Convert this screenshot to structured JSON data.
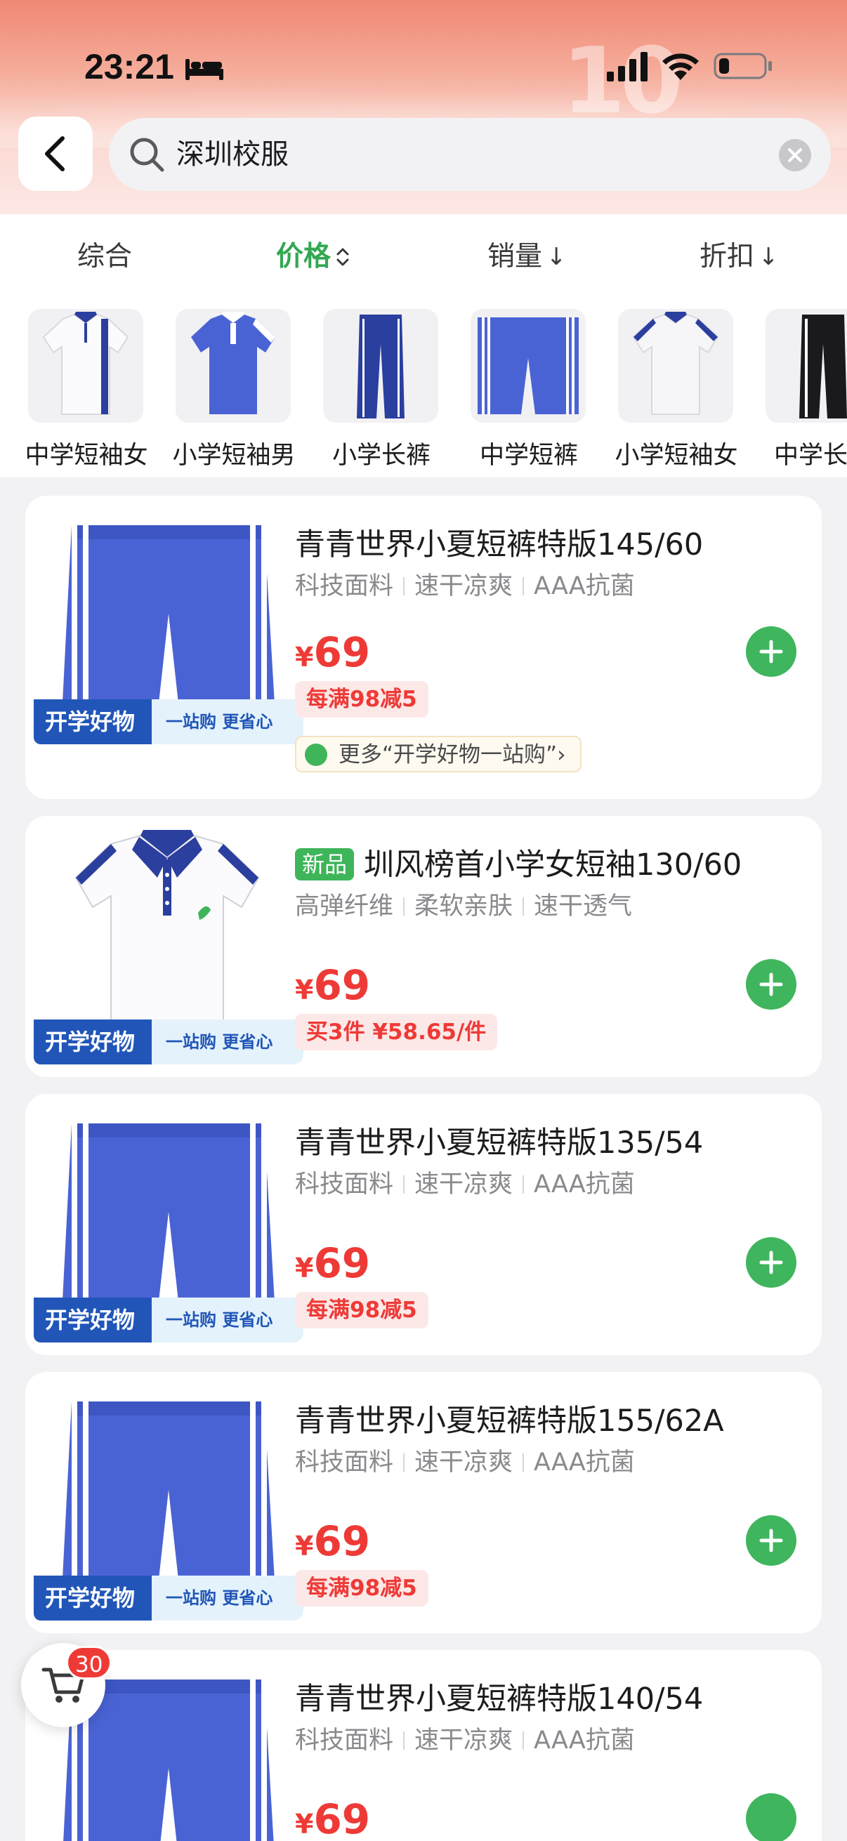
{
  "status_bar": {
    "time": "23:21"
  },
  "header": {
    "watermark": "10"
  },
  "search": {
    "query": "深圳校服"
  },
  "sort_tabs": [
    {
      "label": "综合",
      "arrow": ""
    },
    {
      "label": "价格",
      "arrow": "⌃⌄"
    },
    {
      "label": "销量",
      "arrow": "↓"
    },
    {
      "label": "折扣",
      "arrow": "↓"
    }
  ],
  "categories": [
    {
      "label": "中学短袖女"
    },
    {
      "label": "小学短袖男"
    },
    {
      "label": "小学长裤"
    },
    {
      "label": "中学短裤"
    },
    {
      "label": "小学短袖女"
    },
    {
      "label": "中学长裤"
    }
  ],
  "promo": {
    "left": "开学好物",
    "right": "一站购 更省心"
  },
  "products": [
    {
      "title": "青青世界小夏短裤特版145/60",
      "badge": "",
      "tags": [
        "科技面料",
        "速干凉爽",
        "AAA抗菌"
      ],
      "currency": "¥",
      "price": "69",
      "discount": "每满98减5",
      "more": "更多“开学好物一站购”›"
    },
    {
      "title": "圳风榜首小学女短袖130/60",
      "badge": "新品",
      "tags": [
        "高弹纤维",
        "柔软亲肤",
        "速干透气"
      ],
      "currency": "¥",
      "price": "69",
      "discount": "买3件 ¥58.65/件",
      "more": ""
    },
    {
      "title": "青青世界小夏短裤特版135/54",
      "badge": "",
      "tags": [
        "科技面料",
        "速干凉爽",
        "AAA抗菌"
      ],
      "currency": "¥",
      "price": "69",
      "discount": "每满98减5",
      "more": ""
    },
    {
      "title": "青青世界小夏短裤特版155/62A",
      "badge": "",
      "tags": [
        "科技面料",
        "速干凉爽",
        "AAA抗菌"
      ],
      "currency": "¥",
      "price": "69",
      "discount": "每满98减5",
      "more": ""
    },
    {
      "title": "青青世界小夏短裤特版140/54",
      "badge": "",
      "tags": [
        "科技面料",
        "速干凉爽",
        "AAA抗菌"
      ],
      "currency": "¥",
      "price": "69",
      "discount": "",
      "more": ""
    }
  ],
  "cart": {
    "count": "30"
  },
  "colors": {
    "accent_green": "#3fb55d",
    "price_red": "#ee3a36",
    "uniform_blue": "#4a63d4",
    "promo_blue": "#2156b8"
  }
}
